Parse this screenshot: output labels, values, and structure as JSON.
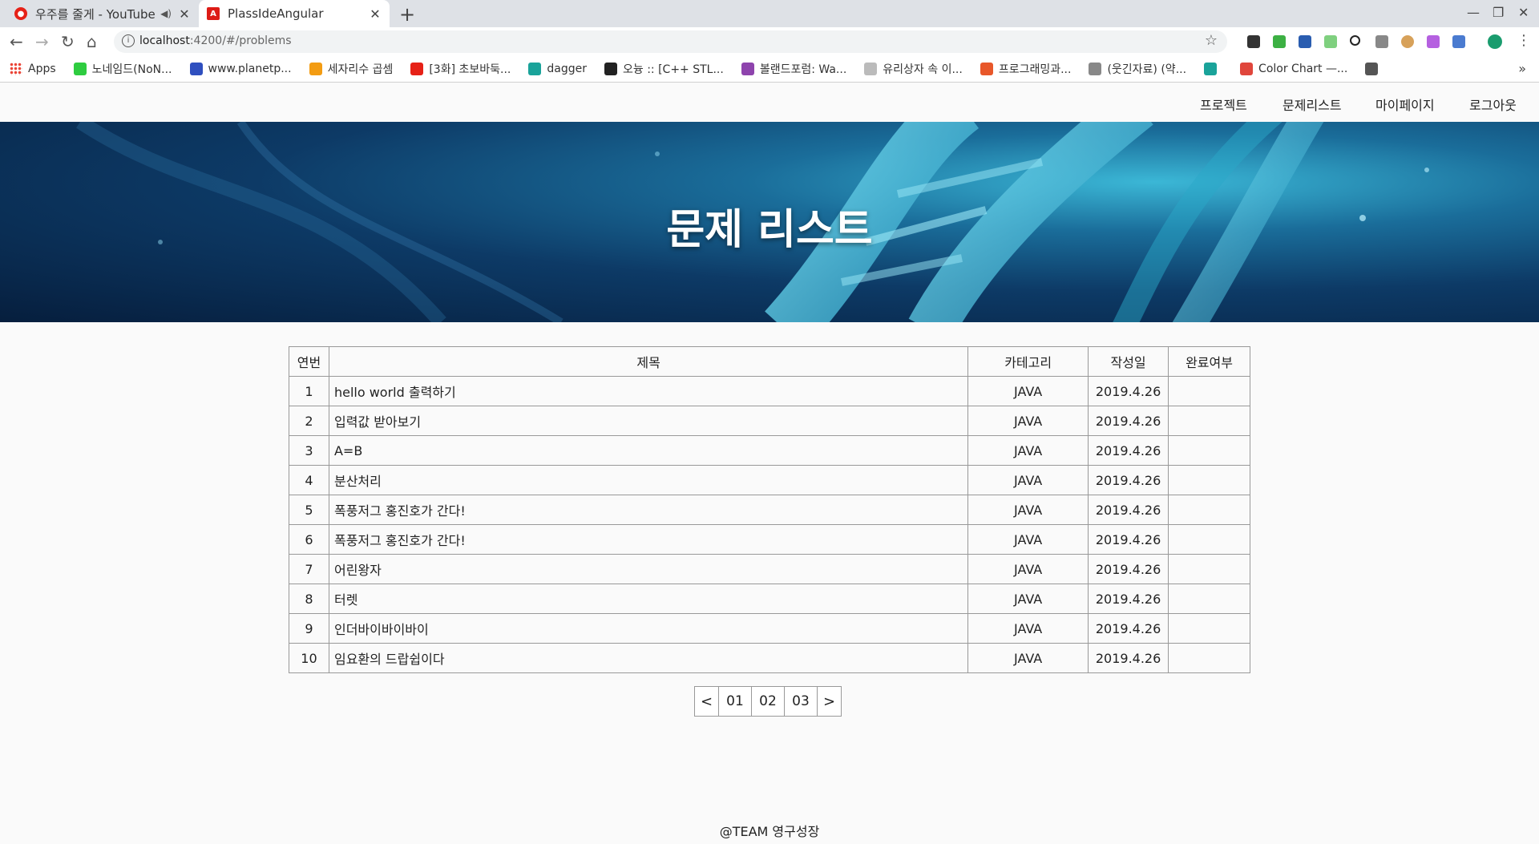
{
  "browser": {
    "tabs": [
      {
        "title": "우주를 줄게 - YouTube M",
        "active": false
      },
      {
        "title": "PlassIdeAngular",
        "active": true
      }
    ],
    "url_host": "localhost",
    "url_path": ":4200/#/problems",
    "bookmarks": [
      {
        "label": "Apps",
        "color": "#4285f4"
      },
      {
        "label": "노네임드(NoN...",
        "color": "#2ecc40"
      },
      {
        "label": "www.planetp...",
        "color": "#2f4fbf"
      },
      {
        "label": "세자리수 곱셈",
        "color": "#f39c12"
      },
      {
        "label": "[3화] 초보바둑...",
        "color": "#e62117"
      },
      {
        "label": "dagger",
        "color": "#1aa39a"
      },
      {
        "label": "오늉 :: [C++ STL...",
        "color": "#222222"
      },
      {
        "label": "볼랜드포럼: Wa...",
        "color": "#8e44ad"
      },
      {
        "label": "유리상자 속 이...",
        "color": "#bbbbbb"
      },
      {
        "label": "프로그래밍과...",
        "color": "#e8572a"
      },
      {
        "label": "(웃긴자료) (약...",
        "color": "#888888"
      },
      {
        "label": "",
        "color": "#1aa39a"
      },
      {
        "label": "Color Chart —...",
        "color": "#e0463c"
      },
      {
        "label": "",
        "color": "#555555"
      }
    ]
  },
  "nav": {
    "project": "프로젝트",
    "problems": "문제리스트",
    "mypage": "마이페이지",
    "logout": "로그아웃"
  },
  "hero": {
    "title": "문제 리스트"
  },
  "table": {
    "headers": [
      "연번",
      "제목",
      "카테고리",
      "작성일",
      "완료여부"
    ],
    "rows": [
      {
        "no": "1",
        "title": "hello world 출력하기",
        "category": "JAVA",
        "date": "2019.4.26",
        "done": ""
      },
      {
        "no": "2",
        "title": "입력값 받아보기",
        "category": "JAVA",
        "date": "2019.4.26",
        "done": ""
      },
      {
        "no": "3",
        "title": "A=B",
        "category": "JAVA",
        "date": "2019.4.26",
        "done": ""
      },
      {
        "no": "4",
        "title": "분산처리",
        "category": "JAVA",
        "date": "2019.4.26",
        "done": ""
      },
      {
        "no": "5",
        "title": "폭풍저그 홍진호가 간다!",
        "category": "JAVA",
        "date": "2019.4.26",
        "done": ""
      },
      {
        "no": "6",
        "title": "폭풍저그 홍진호가 간다!",
        "category": "JAVA",
        "date": "2019.4.26",
        "done": ""
      },
      {
        "no": "7",
        "title": "어린왕자",
        "category": "JAVA",
        "date": "2019.4.26",
        "done": ""
      },
      {
        "no": "8",
        "title": "터렛",
        "category": "JAVA",
        "date": "2019.4.26",
        "done": ""
      },
      {
        "no": "9",
        "title": "인더바이바이바이",
        "category": "JAVA",
        "date": "2019.4.26",
        "done": ""
      },
      {
        "no": "10",
        "title": "임요환의 드랍쉽이다",
        "category": "JAVA",
        "date": "2019.4.26",
        "done": ""
      }
    ]
  },
  "pagination": {
    "prev": "<",
    "pages": [
      "01",
      "02",
      "03"
    ],
    "next": ">"
  },
  "footer": {
    "text": "@TEAM 영구성장"
  }
}
